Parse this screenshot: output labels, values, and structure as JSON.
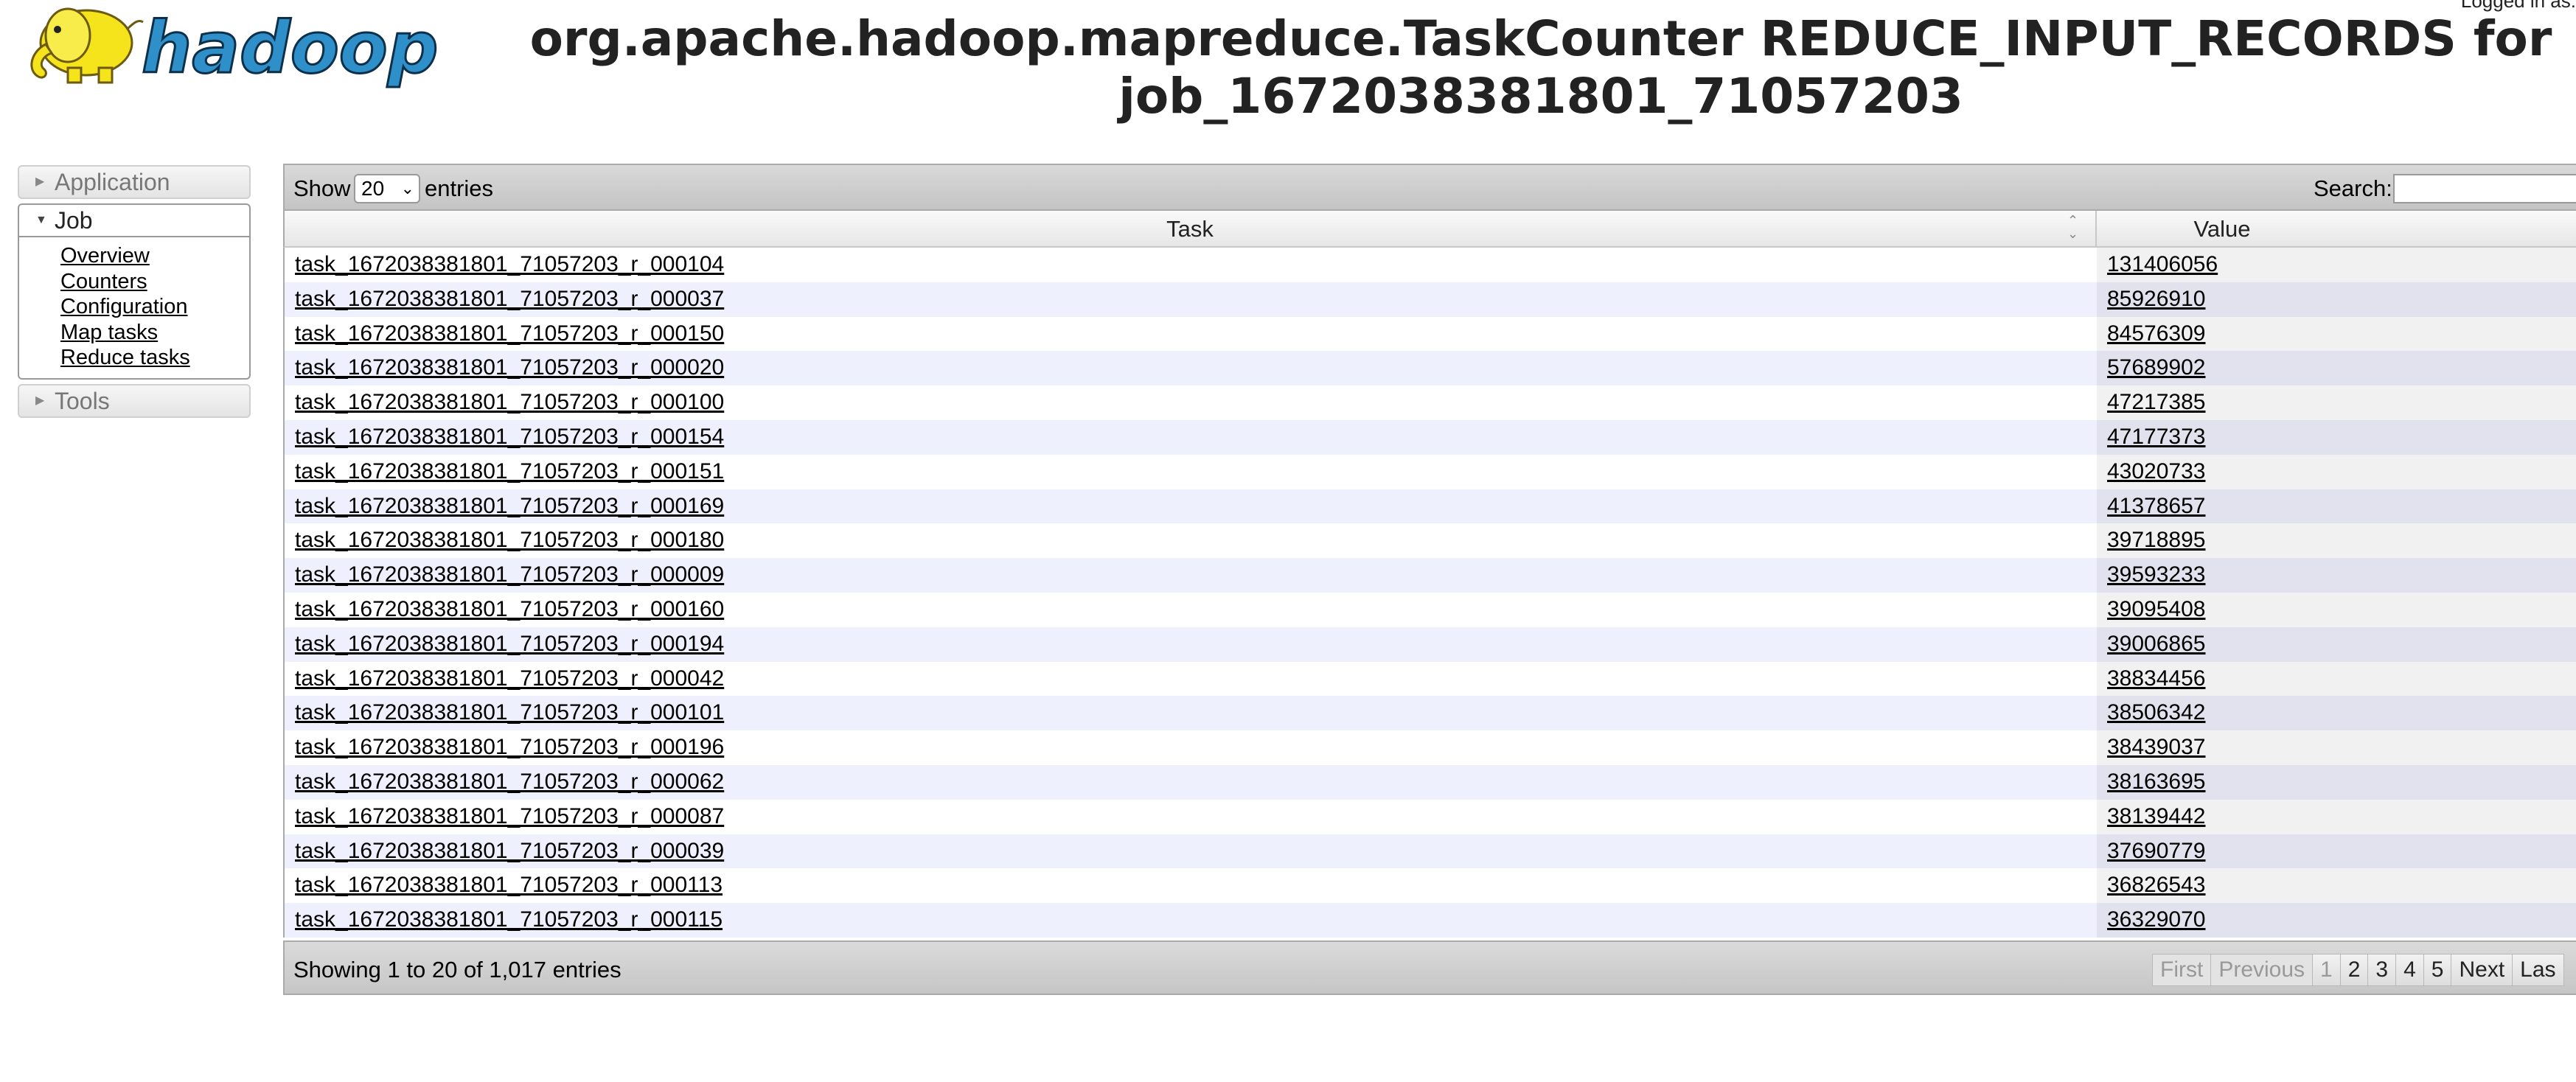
{
  "header": {
    "logged_in": "Logged in as: ",
    "title_line1": "org.apache.hadoop.mapreduce.TaskCounter REDUCE_INPUT_RECORDS for",
    "title_line2": "job_1672038381801_71057203",
    "logo_text": "hadoop"
  },
  "nav": {
    "application": "Application",
    "job": "Job",
    "job_links": [
      "Overview",
      "Counters",
      "Configuration",
      "Map tasks",
      "Reduce tasks"
    ],
    "tools": "Tools"
  },
  "table": {
    "show_label": "Show",
    "page_size": "20",
    "entries_label": "entries",
    "search_label": "Search:",
    "search_value": "",
    "columns": [
      "Task",
      "Value"
    ],
    "rows": [
      [
        "task_1672038381801_71057203_r_000104",
        "131406056"
      ],
      [
        "task_1672038381801_71057203_r_000037",
        "85926910"
      ],
      [
        "task_1672038381801_71057203_r_000150",
        "84576309"
      ],
      [
        "task_1672038381801_71057203_r_000020",
        "57689902"
      ],
      [
        "task_1672038381801_71057203_r_000100",
        "47217385"
      ],
      [
        "task_1672038381801_71057203_r_000154",
        "47177373"
      ],
      [
        "task_1672038381801_71057203_r_000151",
        "43020733"
      ],
      [
        "task_1672038381801_71057203_r_000169",
        "41378657"
      ],
      [
        "task_1672038381801_71057203_r_000180",
        "39718895"
      ],
      [
        "task_1672038381801_71057203_r_000009",
        "39593233"
      ],
      [
        "task_1672038381801_71057203_r_000160",
        "39095408"
      ],
      [
        "task_1672038381801_71057203_r_000194",
        "39006865"
      ],
      [
        "task_1672038381801_71057203_r_000042",
        "38834456"
      ],
      [
        "task_1672038381801_71057203_r_000101",
        "38506342"
      ],
      [
        "task_1672038381801_71057203_r_000196",
        "38439037"
      ],
      [
        "task_1672038381801_71057203_r_000062",
        "38163695"
      ],
      [
        "task_1672038381801_71057203_r_000087",
        "38139442"
      ],
      [
        "task_1672038381801_71057203_r_000039",
        "37690779"
      ],
      [
        "task_1672038381801_71057203_r_000113",
        "36826543"
      ],
      [
        "task_1672038381801_71057203_r_000115",
        "36329070"
      ]
    ],
    "info": "Showing 1 to 20 of 1,017 entries",
    "pagination": {
      "first": "First",
      "previous": "Previous",
      "pages": [
        "1",
        "2",
        "3",
        "4",
        "5"
      ],
      "next": "Next",
      "last": "Las"
    }
  },
  "colors": {
    "row_even": "#eff0fd",
    "row_odd": "#ffffff",
    "logo_yellow": "#f5e31c",
    "logo_blue": "#2f8fc9"
  },
  "icons": [
    "hadoop-elephant-logo",
    "triangle-right-icon",
    "triangle-down-icon",
    "sort-icon",
    "chevron-down-icon"
  ]
}
